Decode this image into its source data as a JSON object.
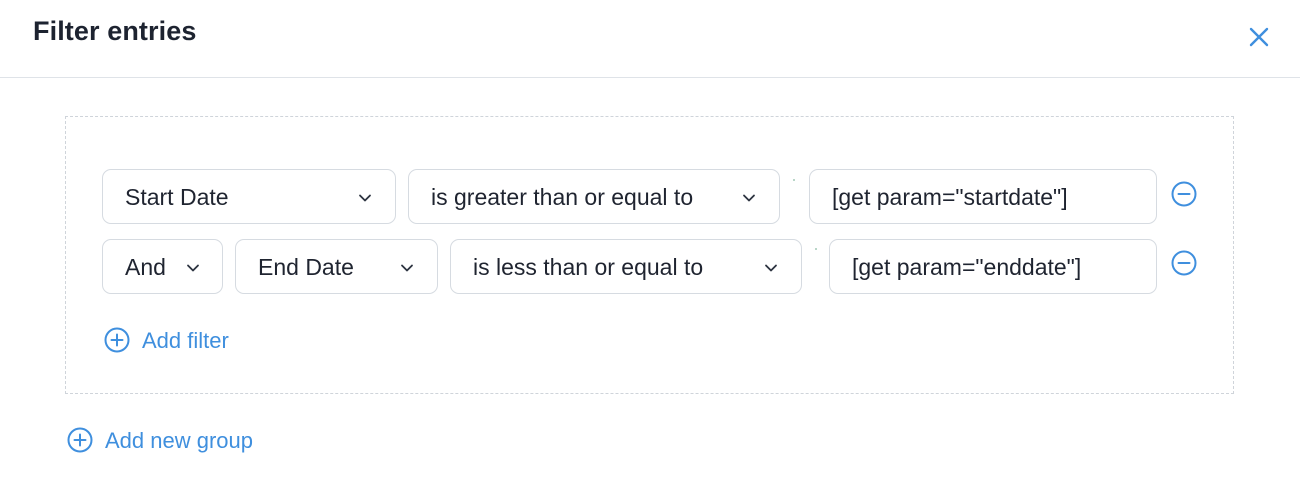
{
  "header": {
    "title": "Filter entries"
  },
  "filters": [
    {
      "field": "Start Date",
      "operator": "is greater than or equal to",
      "value": "[get param=\"startdate\"]"
    },
    {
      "conjunction": "And",
      "field": "End Date",
      "operator": "is less than or equal to",
      "value": "[get param=\"enddate\"]"
    }
  ],
  "actions": {
    "add_filter_label": "Add filter",
    "add_group_label": "Add new group"
  },
  "icons": {
    "close": "close-icon",
    "chevron": "chevron-down-icon",
    "remove": "minus-circle-icon",
    "add": "plus-circle-icon"
  },
  "colors": {
    "accent": "#3f8fde",
    "border": "#d6dbe1",
    "text": "#1f2430"
  }
}
